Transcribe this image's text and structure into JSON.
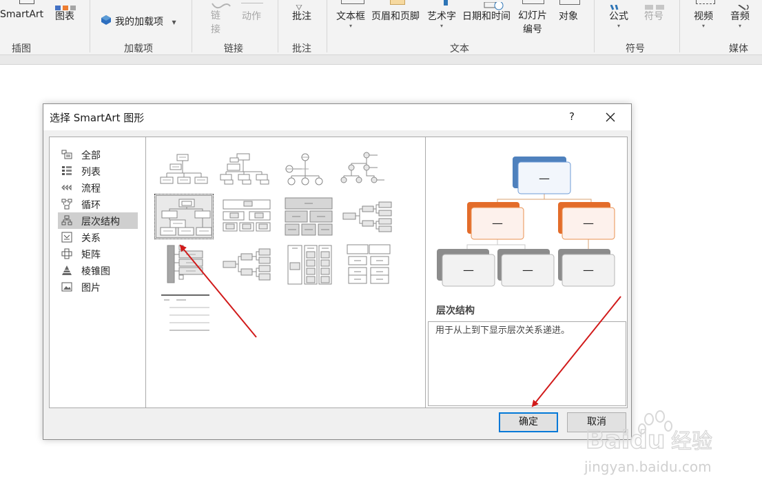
{
  "ribbon": {
    "groups": [
      {
        "name": "illustrations",
        "label": "插图"
      },
      {
        "name": "addins",
        "label": "加载项"
      },
      {
        "name": "links",
        "label": "链接"
      },
      {
        "name": "comments",
        "label": "批注"
      },
      {
        "name": "text",
        "label": "文本"
      },
      {
        "name": "symbols",
        "label": "符号"
      },
      {
        "name": "media",
        "label": "媒体"
      }
    ],
    "buttons": {
      "smartart": "SmartArt",
      "chart": "图表",
      "my_addins": "我的加载项",
      "link_1": "链",
      "link_2": "接",
      "action": "动作",
      "comment": "批注",
      "textbox": "文本框",
      "header_footer": "页眉和页脚",
      "wordart": "艺术字",
      "datetime": "日期和时间",
      "slide_number_1": "幻灯片",
      "slide_number_2": "编号",
      "object": "对象",
      "equation": "公式",
      "symbol": "符号",
      "video": "视频",
      "audio": "音频"
    }
  },
  "dialog": {
    "title": "选择 SmartArt 图形",
    "help": "?",
    "categories": [
      {
        "label": "全部",
        "icon": "all-icon"
      },
      {
        "label": "列表",
        "icon": "list-icon"
      },
      {
        "label": "流程",
        "icon": "process-icon"
      },
      {
        "label": "循环",
        "icon": "cycle-icon"
      },
      {
        "label": "层次结构",
        "icon": "hierarchy-icon",
        "selected": true
      },
      {
        "label": "关系",
        "icon": "relationship-icon"
      },
      {
        "label": "矩阵",
        "icon": "matrix-icon"
      },
      {
        "label": "棱锥图",
        "icon": "pyramid-icon"
      },
      {
        "label": "图片",
        "icon": "picture-icon"
      }
    ],
    "preview": {
      "title": "层次结构",
      "description": "用于从上到下显示层次关系递进。",
      "node_text": "—"
    },
    "ok_label": "确定",
    "cancel_label": "取消"
  },
  "watermark": {
    "brand": "Baidu",
    "brand_cn": "经验",
    "url": "jingyan.baidu.com"
  },
  "colors": {
    "accent_blue": "#4f81bd",
    "accent_orange": "#e36c2a",
    "accent_gray": "#8c8c8c",
    "arrow_red": "#d11a1a",
    "primary_border": "#0078d7"
  }
}
